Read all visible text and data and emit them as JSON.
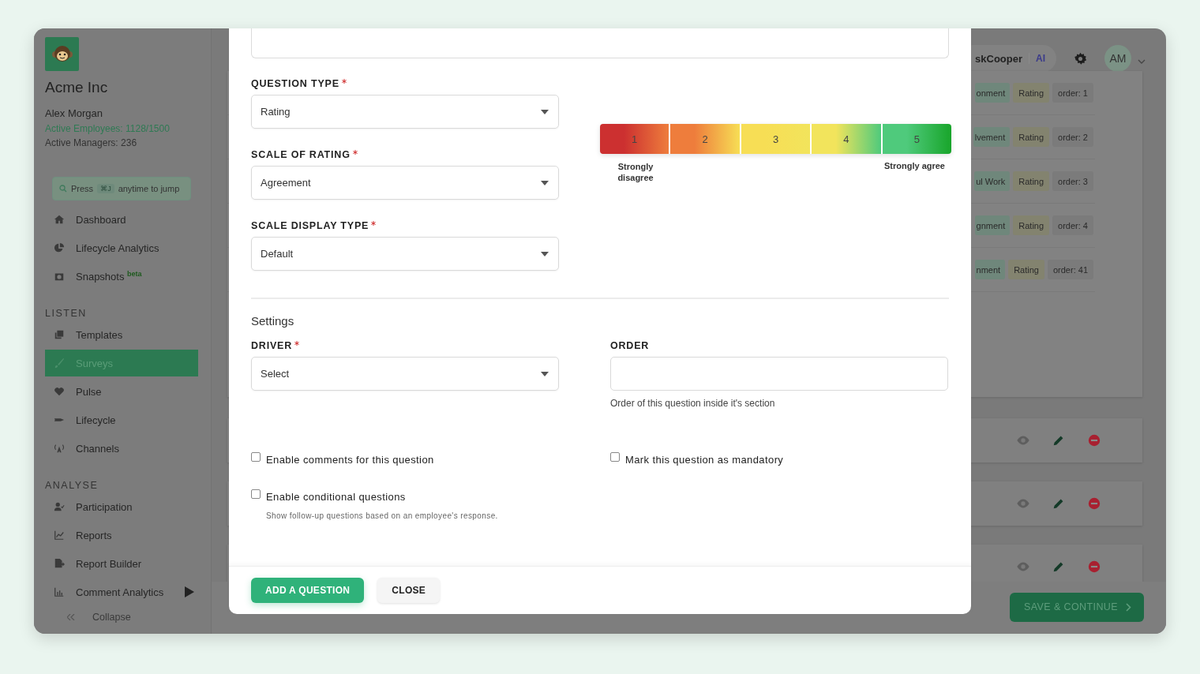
{
  "sidebar": {
    "company": "Acme Inc",
    "user": "Alex Morgan",
    "employees": "Active Employees: 1128/1500",
    "managers": "Active Managers: 236",
    "jump": {
      "before": "Press",
      "key": "⌘J",
      "after": "anytime to jump"
    },
    "sections": [
      {
        "items": [
          {
            "label": "Dashboard",
            "selected": false
          },
          {
            "label": "Lifecycle Analytics",
            "selected": false
          },
          {
            "label": "Snapshots",
            "selected": false,
            "badge": "beta"
          }
        ]
      },
      {
        "heading": "LISTEN",
        "items": [
          {
            "label": "Templates",
            "selected": false
          },
          {
            "label": "Surveys",
            "selected": true
          },
          {
            "label": "Pulse",
            "selected": false
          },
          {
            "label": "Lifecycle",
            "selected": false
          },
          {
            "label": "Channels",
            "selected": false
          }
        ]
      },
      {
        "heading": "ANALYSE",
        "items": [
          {
            "label": "Participation",
            "selected": false
          },
          {
            "label": "Reports",
            "selected": false
          },
          {
            "label": "Report Builder",
            "selected": false
          },
          {
            "label": "Comment Analytics",
            "selected": false,
            "submenu": true
          }
        ]
      }
    ],
    "collapse": "Collapse"
  },
  "header": {
    "brand": "skCooper",
    "ai": "AI",
    "avatar": "AM"
  },
  "question_rows": [
    {
      "driver": "onment",
      "type": "Rating",
      "order": "order: 1"
    },
    {
      "driver": "lvement",
      "type": "Rating",
      "order": "order: 2"
    },
    {
      "driver": "ul Work",
      "type": "Rating",
      "order": "order: 3"
    },
    {
      "driver": "gnment",
      "type": "Rating",
      "order": "order: 4"
    },
    {
      "driver": "nment",
      "type": "Rating",
      "order": "order: 41"
    }
  ],
  "section_cards": [
    {
      "actions": [
        {
          "kind": "view"
        },
        {
          "kind": "edit"
        },
        {
          "kind": "delete"
        }
      ]
    },
    {
      "actions": [
        {
          "kind": "view"
        },
        {
          "kind": "edit"
        },
        {
          "kind": "delete"
        }
      ]
    },
    {
      "actions": [
        {
          "kind": "view"
        },
        {
          "kind": "edit"
        },
        {
          "kind": "delete"
        }
      ]
    }
  ],
  "save_button": "SAVE & CONTINUE",
  "modal": {
    "question_type": {
      "label": "QUESTION TYPE",
      "required": true,
      "value": "Rating"
    },
    "scale_of_rating": {
      "label": "SCALE OF RATING",
      "required": true,
      "value": "Agreement"
    },
    "scale_display_type": {
      "label": "SCALE DISPLAY TYPE",
      "required": true,
      "value": "Default"
    },
    "scale_preview": {
      "points": [
        {
          "label": "1",
          "color": "#cc3030"
        },
        {
          "label": "2",
          "color": "#ee7d3c"
        },
        {
          "label": "3",
          "color": "#f7de55"
        },
        {
          "label": "4",
          "color": "#f2e45c"
        },
        {
          "label": "5",
          "color": "#4fca7c"
        }
      ],
      "min_label": "Strongly disagree",
      "max_label": "Strongly agree"
    },
    "settings_heading": "Settings",
    "driver": {
      "label": "DRIVER",
      "required": true,
      "placeholder": "Select"
    },
    "order": {
      "label": "ORDER",
      "help": "Order of this question inside it's section"
    },
    "checkboxes": [
      {
        "label": "Enable comments for this question",
        "checked": false
      },
      {
        "label": "Mark this question as mandatory",
        "checked": false
      },
      {
        "label": "Enable conditional questions",
        "checked": false,
        "help": "Show follow-up questions based on an employee's response."
      }
    ],
    "buttons": [
      {
        "label": "ADD A QUESTION",
        "kind": "primary"
      },
      {
        "label": "CLOSE",
        "kind": "secondary"
      }
    ]
  }
}
